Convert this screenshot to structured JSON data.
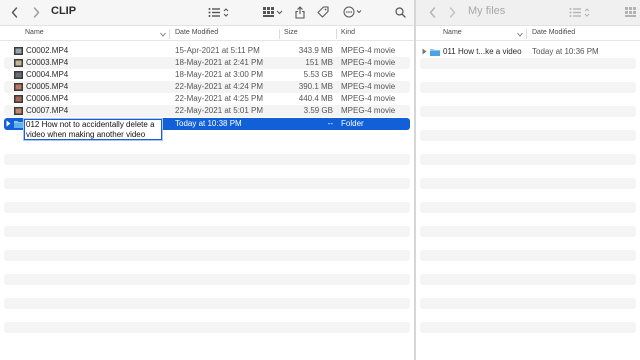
{
  "left": {
    "title": "CLIP",
    "columns": {
      "name": "Name",
      "date": "Date Modified",
      "size": "Size",
      "kind": "Kind"
    },
    "files": [
      {
        "name": "C0002.MP4",
        "date": "15-Apr-2021 at 5:11 PM",
        "size": "343.9 MB",
        "kind": "MPEG-4 movie"
      },
      {
        "name": "C0003.MP4",
        "date": "18-May-2021 at 2:41 PM",
        "size": "151 MB",
        "kind": "MPEG-4 movie"
      },
      {
        "name": "C0004.MP4",
        "date": "18-May-2021 at 3:00 PM",
        "size": "5.53 GB",
        "kind": "MPEG-4 movie"
      },
      {
        "name": "C0005.MP4",
        "date": "22-May-2021 at 4:24 PM",
        "size": "390.1 MB",
        "kind": "MPEG-4 movie"
      },
      {
        "name": "C0006.MP4",
        "date": "22-May-2021 at 4:25 PM",
        "size": "440.4 MB",
        "kind": "MPEG-4 movie"
      },
      {
        "name": "C0007.MP4",
        "date": "22-May-2021 at 5:01 PM",
        "size": "3.59 GB",
        "kind": "MPEG-4 movie"
      }
    ],
    "selected_folder": {
      "name_editing": "012 How not to accidentally delete a video when making another video",
      "date": "Today at 10:38 PM",
      "size": "--",
      "kind": "Folder"
    }
  },
  "right": {
    "title": "My files",
    "columns": {
      "name": "Name",
      "date": "Date Modified"
    },
    "items": [
      {
        "name": "011 How t...ke a video",
        "date": "Today at 10:36 PM"
      }
    ]
  },
  "colors": {
    "selection": "#1260d8",
    "folder": "#4aa3e6",
    "stripe": "#f4f4f4"
  },
  "icons": [
    "back-chevron-icon",
    "forward-chevron-icon",
    "list-view-icon",
    "grid-view-icon",
    "share-icon",
    "tag-icon",
    "more-icon",
    "search-icon",
    "folder-icon",
    "video-file-icon",
    "disclosure-triangle-icon"
  ]
}
